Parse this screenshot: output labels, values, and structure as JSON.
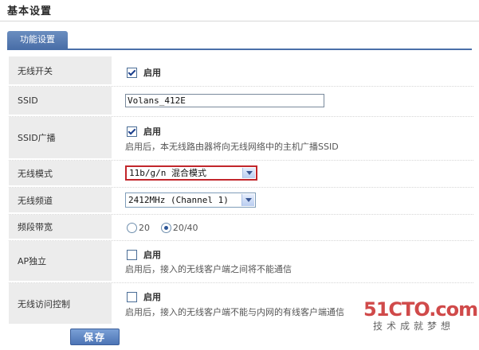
{
  "page_title": "基本设置",
  "tab": {
    "label": "功能设置"
  },
  "rows": {
    "wireless_switch": {
      "label": "无线开关",
      "checked": true,
      "option": "启用"
    },
    "ssid": {
      "label": "SSID",
      "value": "Volans_412E"
    },
    "ssid_broadcast": {
      "label": "SSID广播",
      "checked": true,
      "option": "启用",
      "hint": "启用后，本无线路由器将向无线网络中的主机广播SSID"
    },
    "wireless_mode": {
      "label": "无线模式",
      "value": "11b/g/n 混合模式"
    },
    "wireless_channel": {
      "label": "无线频道",
      "value": "2412MHz (Channel 1)"
    },
    "bandwidth": {
      "label": "频段带宽",
      "options": [
        "20",
        "20/40"
      ],
      "selected": "20/40"
    },
    "ap_isolation": {
      "label": "AP独立",
      "checked": false,
      "option": "启用",
      "hint": "启用后，接入的无线客户端之间将不能通信"
    },
    "access_control": {
      "label": "无线访问控制",
      "checked": false,
      "option": "启用",
      "hint": "启用后，接入的无线客户端不能与内网的有线客户端通信"
    }
  },
  "save_label": "保存",
  "watermark": {
    "top": "51CTO.com",
    "bottom": "技术成就梦想"
  },
  "colors": {
    "tab": "#4a6fa8",
    "mode_border": "#c2262b",
    "watermark": "#d04a4a"
  }
}
